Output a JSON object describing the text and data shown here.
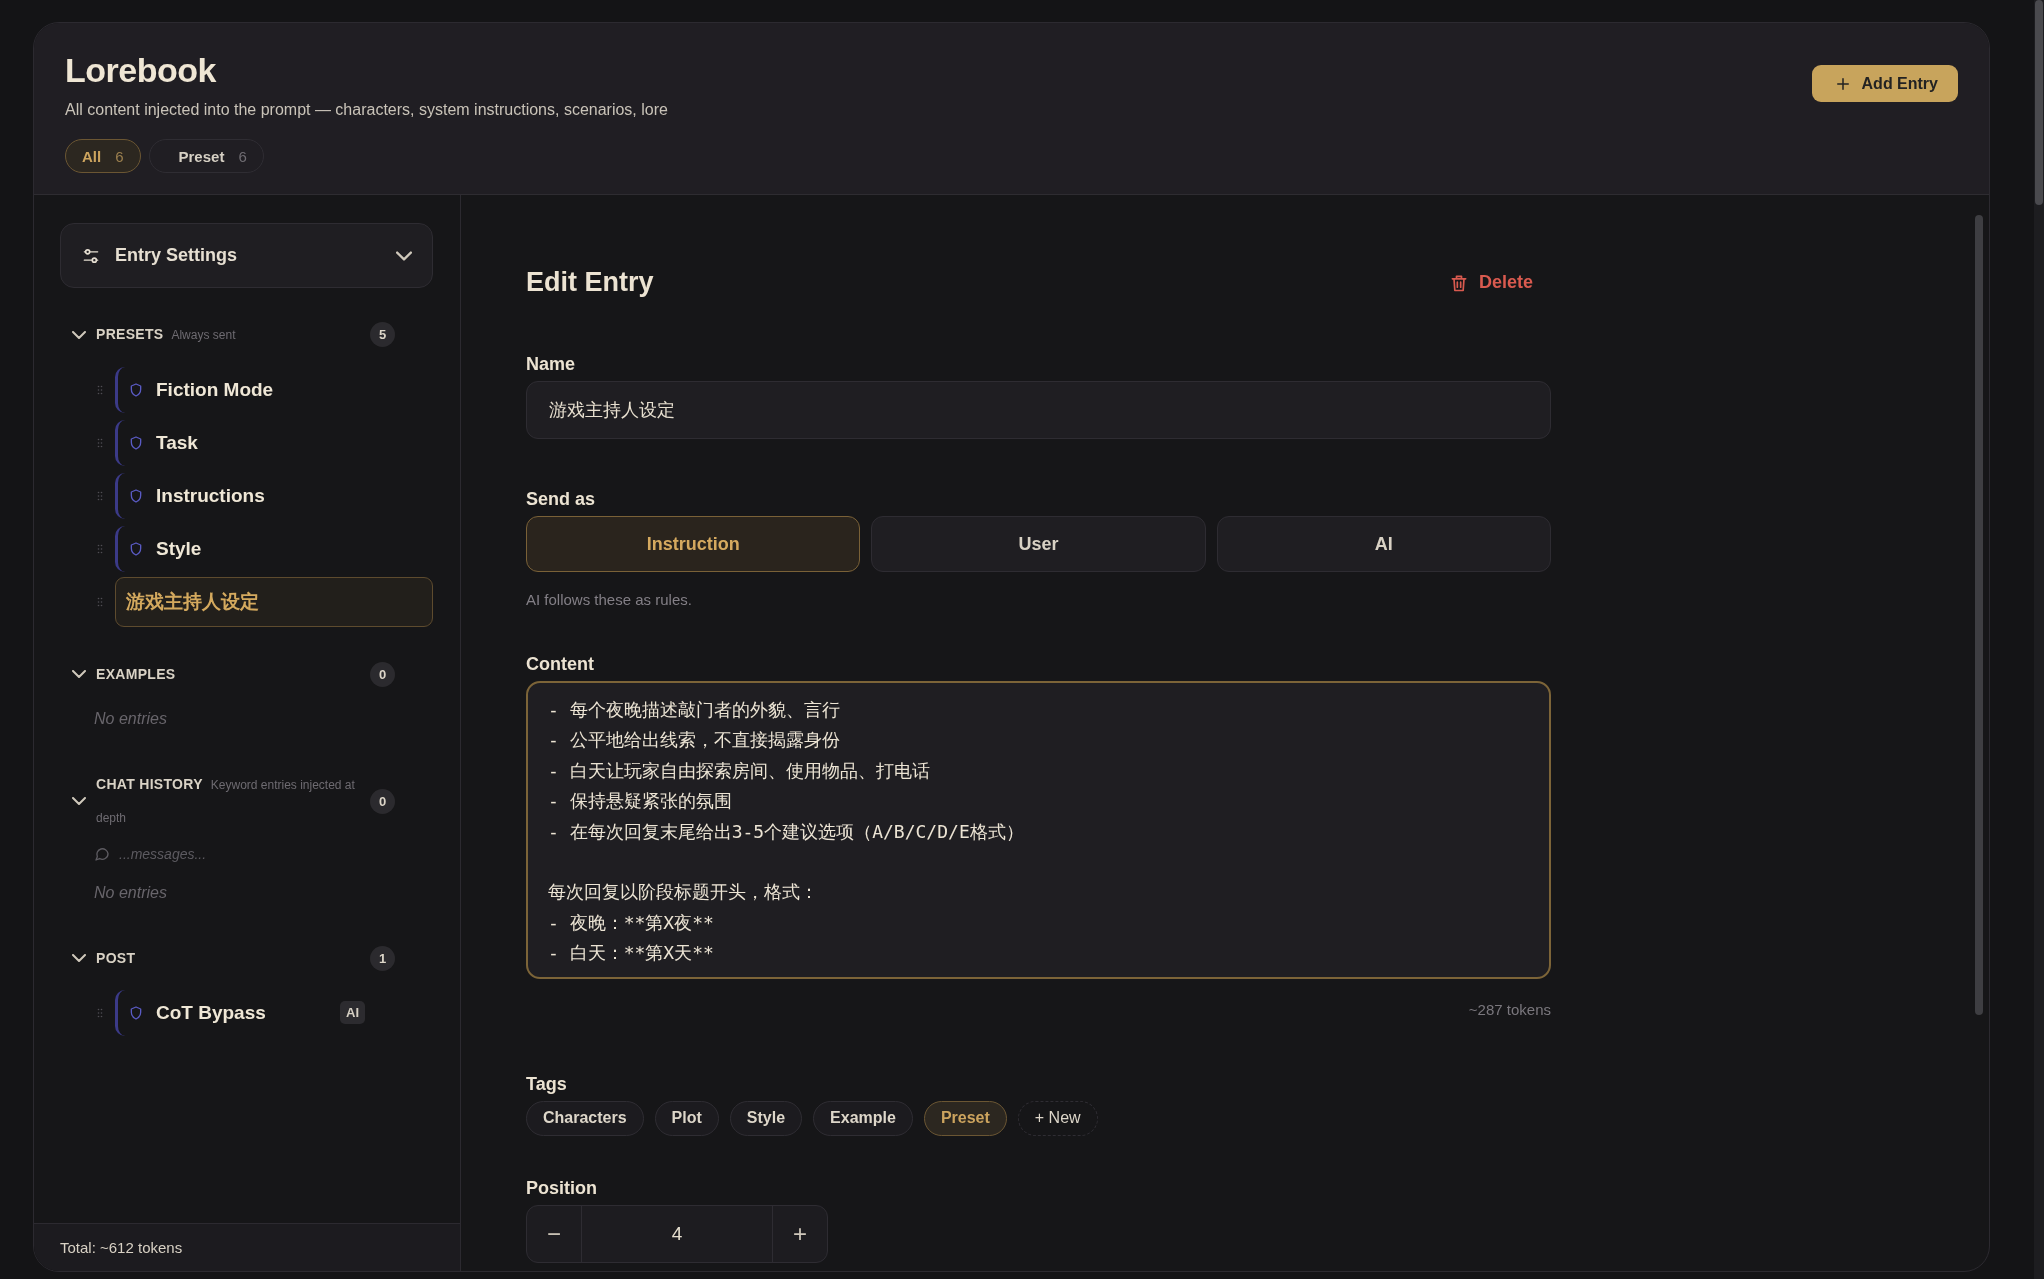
{
  "header": {
    "title": "Lorebook",
    "subtitle": "All content injected into the prompt — characters, system instructions, scenarios, lore",
    "add_button": "Add Entry"
  },
  "filters": [
    {
      "label": "All",
      "count": "6",
      "selected": true
    },
    {
      "label": "Preset",
      "count": "6",
      "selected": false
    }
  ],
  "sidebar": {
    "settings_label": "Entry Settings",
    "sections": [
      {
        "title": "PRESETS",
        "note": "Always sent",
        "count": "5",
        "expanded": true,
        "items": [
          {
            "label": "Fiction Mode",
            "selected": false
          },
          {
            "label": "Task",
            "selected": false
          },
          {
            "label": "Instructions",
            "selected": false
          },
          {
            "label": "Style",
            "selected": false
          },
          {
            "label": "游戏主持人设定",
            "selected": true
          }
        ]
      },
      {
        "title": "EXAMPLES",
        "count": "0",
        "expanded": true,
        "empty_text": "No entries"
      },
      {
        "title": "CHAT HISTORY",
        "note": "Keyword entries injected at depth",
        "count": "0",
        "expanded": true,
        "marker": "...messages...",
        "empty_text": "No entries"
      },
      {
        "title": "POST",
        "count": "1",
        "expanded": true,
        "items": [
          {
            "label": "CoT Bypass",
            "selected": false,
            "badge": "AI"
          }
        ]
      }
    ],
    "total": "Total: ~612 tokens"
  },
  "editor": {
    "heading": "Edit Entry",
    "delete_label": "Delete",
    "name": {
      "label": "Name",
      "value": "游戏主持人设定"
    },
    "send_as": {
      "label": "Send as",
      "options": [
        {
          "label": "Instruction",
          "selected": true
        },
        {
          "label": "User",
          "selected": false
        },
        {
          "label": "AI",
          "selected": false
        }
      ],
      "hint": "AI follows these as rules."
    },
    "content": {
      "label": "Content",
      "paragraphs": [
        [
          "- 每个夜晚描述敲门者的外貌、言行",
          "- 公平地给出线索，不直接揭露身份",
          "- 白天让玩家自由探索房间、使用物品、打电话",
          "- 保持悬疑紧张的氛围",
          "- 在每次回复末尾给出3-5个建议选项（A/B/C/D/E格式）"
        ],
        [
          "每次回复以阶段标题开头，格式：",
          "- 夜晚：**第X夜**",
          "- 白天：**第X天**"
        ]
      ],
      "tokens": "~287 tokens"
    },
    "tags": {
      "label": "Tags",
      "items": [
        {
          "label": "Characters",
          "selected": false
        },
        {
          "label": "Plot",
          "selected": false
        },
        {
          "label": "Style",
          "selected": false
        },
        {
          "label": "Example",
          "selected": false
        },
        {
          "label": "Preset",
          "selected": true
        }
      ],
      "new_label": "+ New"
    },
    "position": {
      "label": "Position",
      "value": "4",
      "minus": "−",
      "plus": "+"
    }
  }
}
